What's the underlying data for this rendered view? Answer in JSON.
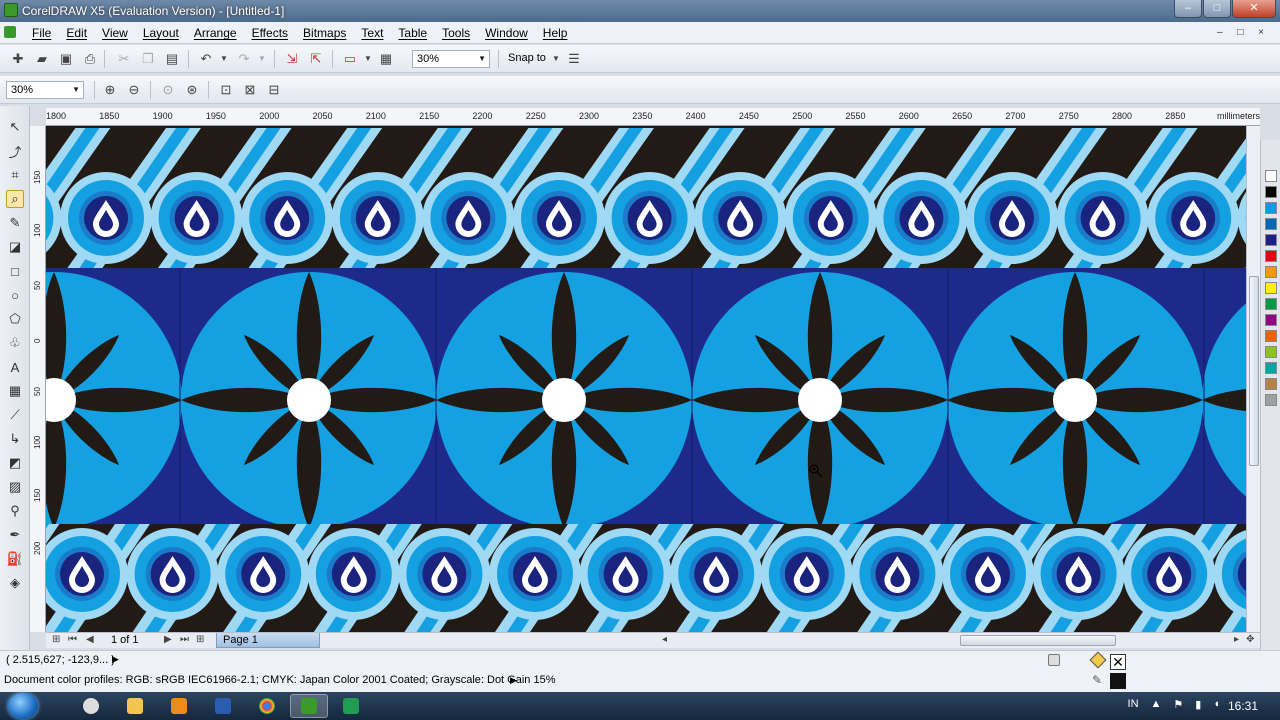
{
  "window": {
    "title": "CorelDRAW X5 (Evaluation Version) - [Untitled-1]",
    "min": "–",
    "max": "□",
    "close": "✕"
  },
  "menu": {
    "items": [
      "File",
      "Edit",
      "View",
      "Layout",
      "Arrange",
      "Effects",
      "Bitmaps",
      "Text",
      "Table",
      "Tools",
      "Window",
      "Help"
    ],
    "doc_controls": "– □ ×"
  },
  "toolbar": {
    "zoom_value": "30%",
    "snap_to_label": "Snap to"
  },
  "property_bar": {
    "zoom_value": "30%"
  },
  "ruler": {
    "unit": "millimeters",
    "h_ticks": [
      "1800",
      "1850",
      "1900",
      "1950",
      "2000",
      "2050",
      "2100",
      "2150",
      "2200",
      "2250",
      "2300",
      "2350",
      "2400",
      "2450",
      "2500",
      "2550",
      "2600",
      "2650",
      "2700",
      "2750",
      "2800",
      "2850"
    ],
    "v_ticks": [
      "150",
      "100",
      "50",
      "0",
      "50",
      "100",
      "150",
      "200"
    ]
  },
  "page_nav": {
    "page_count": "1 of 1",
    "page_tab": "Page 1"
  },
  "status": {
    "coords": "( 2.515,627; -123,9... )",
    "color_profiles": "Document color profiles: RGB: sRGB IEC61966-2.1; CMYK: Japan Color 2001 Coated; Grayscale: Dot Gain 15%"
  },
  "palette": {
    "colors": [
      "#ffffff",
      "#000000",
      "#00a0e9",
      "#0068b7",
      "#1d2088",
      "#e60012",
      "#f39800",
      "#fff100",
      "#009944",
      "#920783",
      "#eb6100",
      "#8fc31f",
      "#00a7a0",
      "#b28247",
      "#9fa0a0"
    ]
  },
  "taskbar": {
    "lang": "IN",
    "clock": "16:31"
  },
  "artwork": {
    "colors": {
      "bg_dark": "#221a14",
      "band_blue": "#1e2a8a",
      "cyan": "#15a0e2",
      "light_cyan": "#9fd9f4",
      "mid_blue": "#1a7cc8",
      "navy": "#1a237e",
      "white": "#ffffff"
    }
  }
}
